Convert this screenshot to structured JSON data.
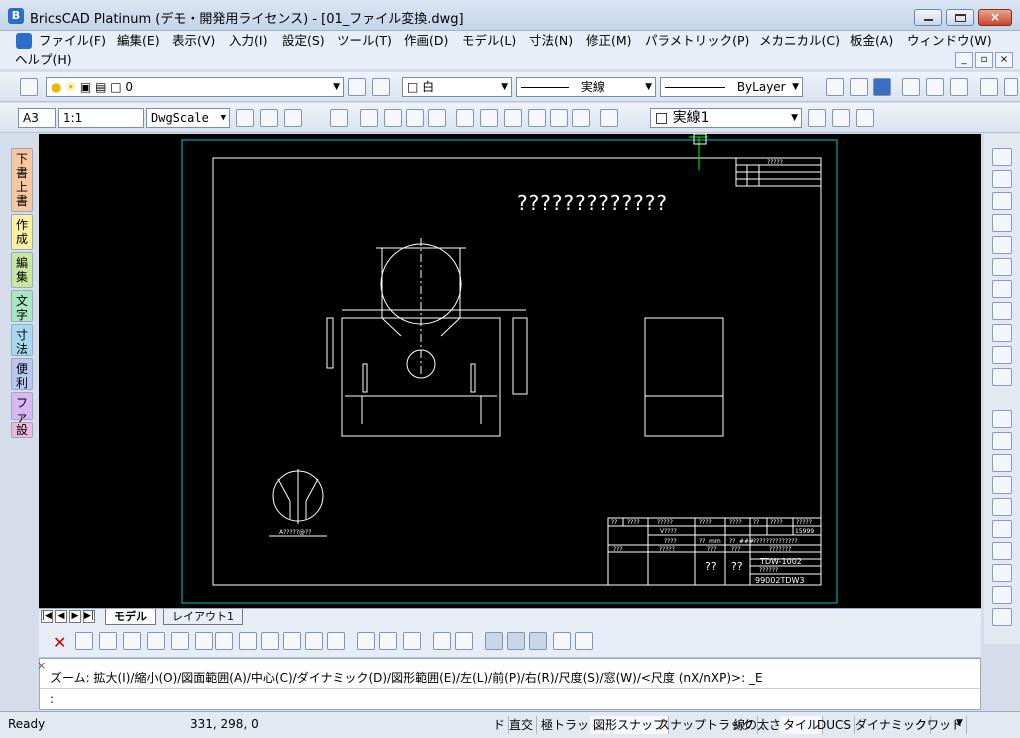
{
  "window": {
    "title": "BricsCAD Platinum (デモ・開発用ライセンス) - [01_ファイル変換.dwg]"
  },
  "menu": {
    "items": [
      "ファイル(F)",
      "編集(E)",
      "表示(V)",
      "入力(I)",
      "設定(S)",
      "ツール(T)",
      "作画(D)",
      "モデル(L)",
      "寸法(N)",
      "修正(M)",
      "パラメトリック(P)",
      "メカニカル(C)",
      "板金(A)",
      "ウィンドウ(W)"
    ],
    "help": "ヘルプ(H)"
  },
  "toolbar1": {
    "layer": "0",
    "color": "白",
    "linetype": "実線",
    "lineweight": "ByLayer"
  },
  "toolbar2": {
    "paper": "A3",
    "scale": "1:1",
    "dimstyle": "DwgScale",
    "linetype2": "実線1"
  },
  "left_tabs": [
    "下書上書",
    "作成",
    "編集",
    "文字",
    "寸法",
    "便利",
    "ファ",
    "設"
  ],
  "drawing": {
    "title_text": "?????????????",
    "label_detail": "A?????@??",
    "tb_top": "?????",
    "tb_cells": [
      "??",
      "????",
      "?????",
      "????",
      "????",
      "??",
      "????",
      "?????"
    ],
    "tb_v": "V????",
    "tb_num": "15999",
    "tb_row2": [
      "????",
      "??",
      "mm",
      "??",
      "###",
      "??????????????"
    ],
    "tb_row3": [
      "???",
      "?????",
      "???",
      "???",
      "???????"
    ],
    "tb_code": "TDW-1002",
    "tb_q1": "??",
    "tb_q2": "??",
    "tb_small": "??????",
    "tb_dwg": "99002TDW3"
  },
  "layout_tabs": {
    "model": "モデル",
    "layout1": "レイアウト1"
  },
  "command": {
    "prompt": "ズーム: 拡大(I)/縮小(O)/図面範囲(A)/中心(C)/ダイナミック(D)/図形範囲(E)/左(L)/前(P)/右(R)/尺度(S)/窓(W)/<尺度 (nX/nXP)>: _E",
    "input": ":"
  },
  "status": {
    "ready": "Ready",
    "coords": "331, 298, 0",
    "toggles": [
      "ド",
      "直交",
      "極トラック",
      "図形スナップ",
      "スナップトラック",
      "線の太さ",
      "タイル",
      "DUCS",
      "ダイナミック",
      "クワッド"
    ]
  },
  "colors": {
    "accent": "#2d6fc8",
    "canvas": "#000000",
    "paper_border": "#00c8c8"
  }
}
